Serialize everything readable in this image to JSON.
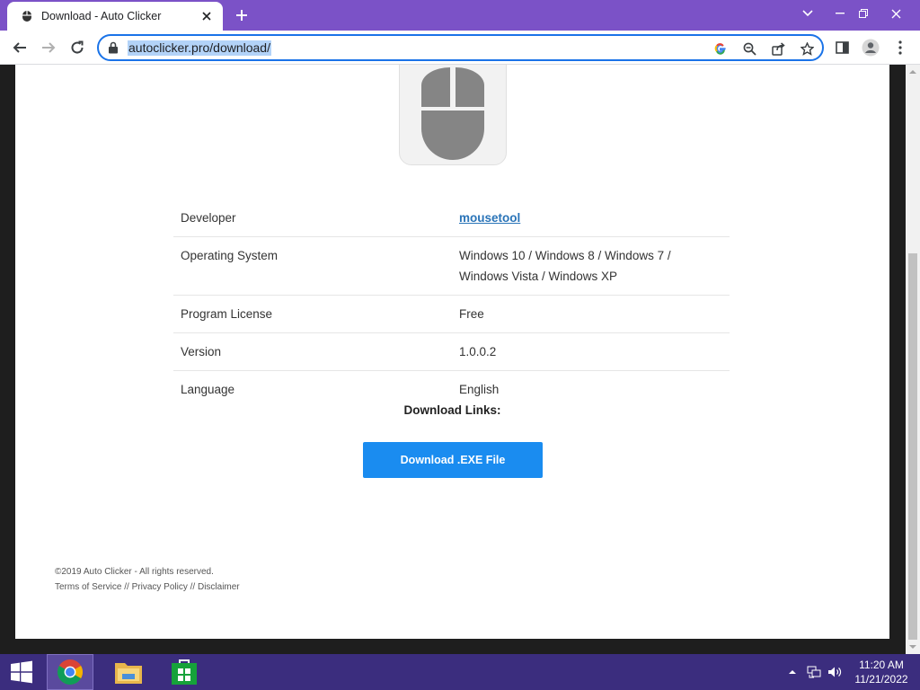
{
  "browser": {
    "tab_title": "Download - Auto Clicker",
    "url": "autoclicker.pro/download/"
  },
  "details": [
    {
      "label": "Developer",
      "value": "mousetool",
      "link": true
    },
    {
      "label": "Operating System",
      "value": "Windows 10 / Windows 8 / Windows 7 / Windows Vista / Windows XP"
    },
    {
      "label": "Program License",
      "value": "Free"
    },
    {
      "label": "Version",
      "value": "1.0.0.2"
    },
    {
      "label": "Language",
      "value": "English"
    }
  ],
  "download": {
    "heading": "Download Links:",
    "button_label": "Download .EXE File"
  },
  "footer": {
    "copyright": "©2019 Auto Clicker - All rights reserved.",
    "links": [
      "Terms of Service",
      "Privacy Policy",
      "Disclaimer"
    ],
    "separator": " // "
  },
  "taskbar": {
    "time": "11:20 AM",
    "date": "11/21/2022",
    "apps": [
      "chrome-icon",
      "file-explorer-icon",
      "store-icon"
    ]
  },
  "colors": {
    "chrome_frame": "#7b52c7",
    "omnibox_focus": "#1a73e8",
    "download_button": "#1a8cf0",
    "link": "#2a74b8",
    "taskbar": "#3b2d7e"
  }
}
